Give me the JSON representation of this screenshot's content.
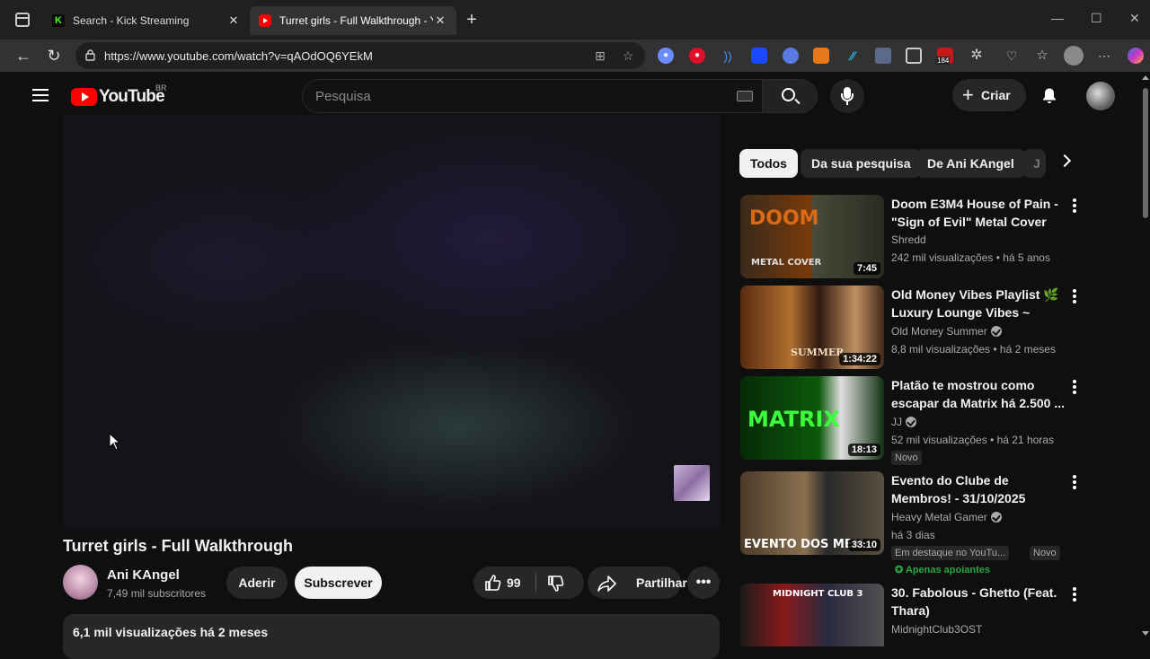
{
  "browser": {
    "tabs": [
      {
        "title": "Search - Kick Streaming",
        "icon": "kick-icon"
      },
      {
        "title": "Turret girls - Full Walkthrough - YouTube",
        "icon": "youtube-icon"
      }
    ],
    "url": "https://www.youtube.com/watch?v=qAOdOQ6YEkM",
    "extension_badge": "184"
  },
  "youtube": {
    "country": "BR",
    "logo_text": "YouTube",
    "search_placeholder": "Pesquisa",
    "create_label": "Criar"
  },
  "video": {
    "title": "Turret girls - Full Walkthrough",
    "channel": "Ani KAngel",
    "subscribers": "7,49 mil subscritores",
    "join_label": "Aderir",
    "subscribe_label": "Subscrever",
    "likes": "99",
    "share_label": "Partilhar",
    "views_date": "6,1 mil visualizações  há 2 meses"
  },
  "chips": [
    "Todos",
    "Da sua pesquisa",
    "De Ani KAngel",
    "J"
  ],
  "recommendations": [
    {
      "title": "Doom E3M4 House of Pain - \"Sign of Evil\" Metal Cover",
      "channel": "Shredd",
      "stats": "242 mil visualizações • há 5 anos",
      "duration": "7:45"
    },
    {
      "title": "Old Money Vibes Playlist 🌿 Luxury Lounge Vibes ~ classy ...",
      "channel": "Old Money Summer",
      "stats": "8,8 mil visualizações • há 2 meses",
      "duration": "1:34:22"
    },
    {
      "title": "Platão te mostrou como escapar da Matrix há 2.500 ...",
      "channel": "JJ",
      "stats": "52 mil visualizações • há 21 horas",
      "duration": "18:13",
      "badge": "Novo"
    },
    {
      "title": "Evento do Clube de Membros! - 31/10/2025",
      "channel": "Heavy Metal Gamer",
      "stats": "há 3 dias",
      "duration": "33:10",
      "badge1": "Em destaque no YouTu...",
      "badge2": "Novo",
      "members": "Apenas apoiantes"
    },
    {
      "title": "30. Fabolous - Ghetto (Feat. Thara)",
      "channel": "MidnightClub3OST",
      "stats": "",
      "duration": ""
    }
  ],
  "thumbnail_text": {
    "doom": "DOOM",
    "doom_sub": "METAL COVER",
    "money": "SUMMER",
    "matrix": "MATRIX",
    "clube": "EVENTO DOS MEM",
    "mc": "MIDNIGHT CLUB 3"
  },
  "colors": {
    "accent": "#ff0000",
    "background": "#0f0f0f",
    "chip_active": "#f1f1f1",
    "members_green": "#2ba640"
  }
}
